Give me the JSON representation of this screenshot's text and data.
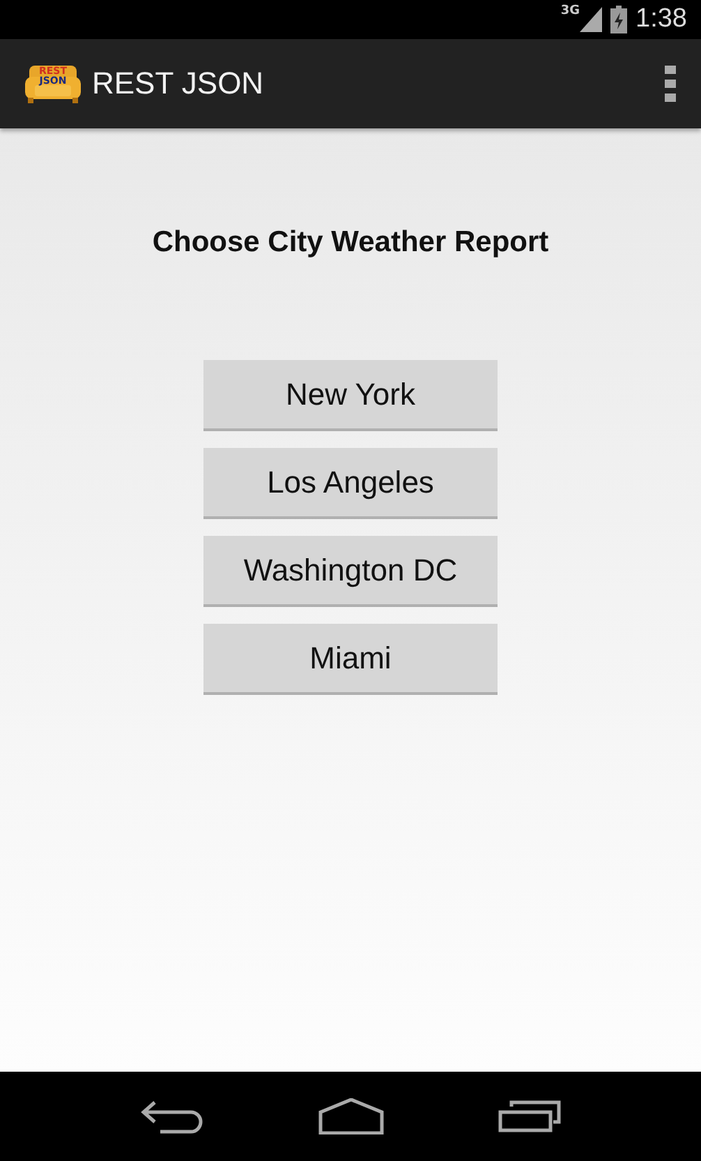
{
  "status_bar": {
    "network": "3G",
    "time": "1:38"
  },
  "action_bar": {
    "logo_text": [
      "REST",
      "JSON"
    ],
    "title": "REST JSON"
  },
  "content": {
    "heading": "Choose City Weather Report",
    "buttons": [
      "New York",
      "Los Angeles",
      "Washington DC",
      "Miami"
    ]
  }
}
